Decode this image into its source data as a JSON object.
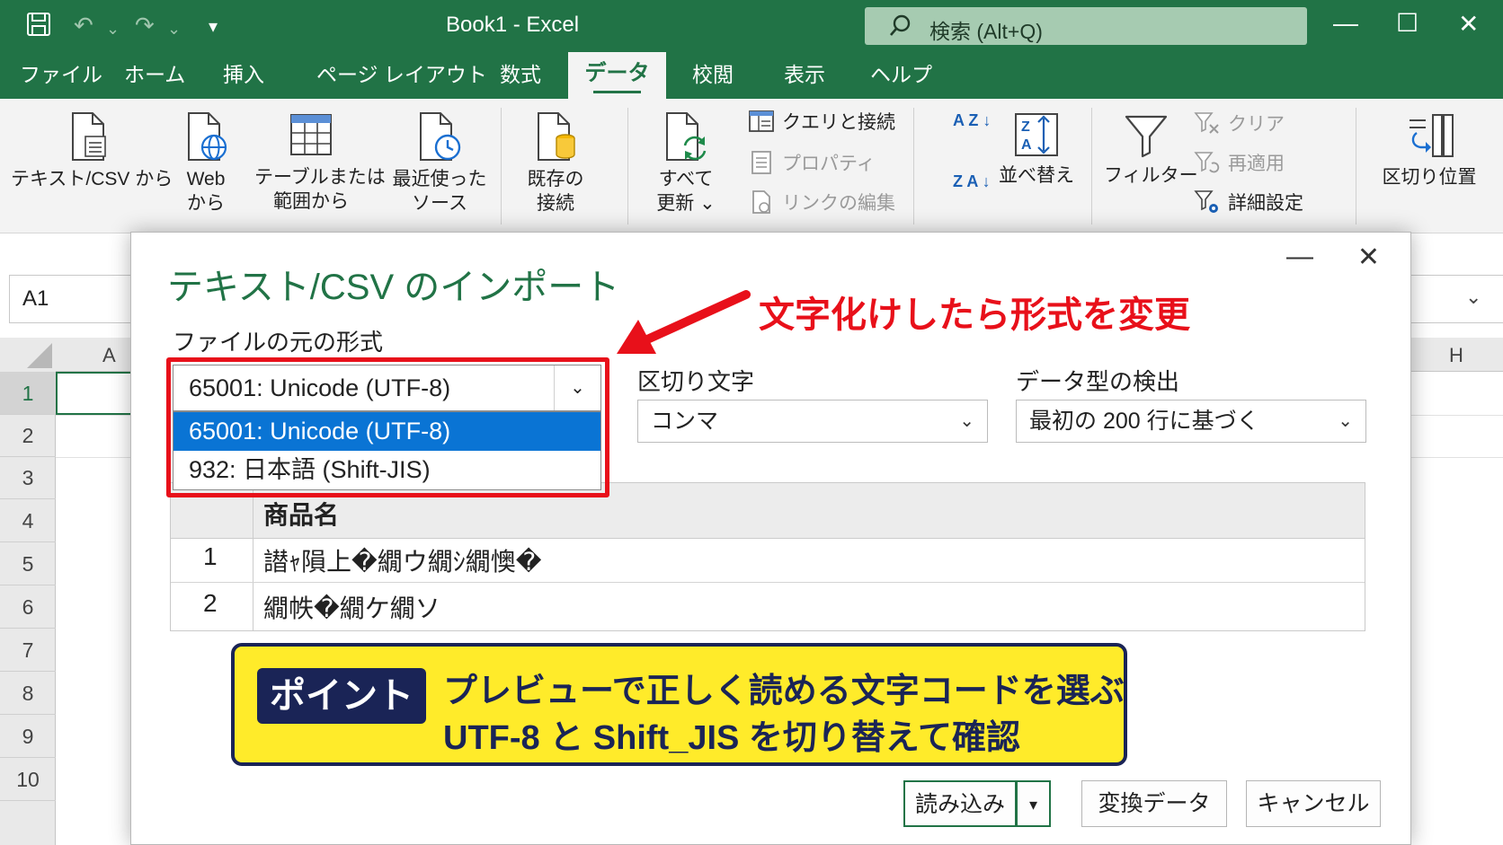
{
  "titlebar": {
    "doc_title": "Book1  -  Excel",
    "search_placeholder": "検索 (Alt+Q)",
    "undo_dropdown": "⌄",
    "redo_dropdown": "⌄",
    "customize_glyph": "▾",
    "minimize_glyph": "—",
    "maximize_glyph": "☐",
    "close_glyph": "✕"
  },
  "tabs": [
    {
      "label": "ファイル"
    },
    {
      "label": "ホーム"
    },
    {
      "label": "挿入"
    },
    {
      "label": "ページ レイアウト"
    },
    {
      "label": "数式"
    },
    {
      "label": "データ"
    },
    {
      "label": "校閲"
    },
    {
      "label": "表示"
    },
    {
      "label": "ヘルプ"
    }
  ],
  "ribbon": {
    "text_csv_line1": "テキスト/CSV から",
    "web_line1": "Web",
    "web_line2": "から",
    "table_line1": "テーブルまたは",
    "table_line2": "範囲から",
    "recent_line1": "最近使った",
    "recent_line2": "ソース",
    "existing_line1": "既存の",
    "existing_line2": "接続",
    "refresh_line1": "すべて",
    "refresh_line2": "更新 ⌄",
    "queries": "クエリと接続",
    "properties": "プロパティ",
    "edit_links": "リンクの編集",
    "sort_az": "A Z ↓",
    "sort_za": "Z A ↓",
    "sort": "並べ替え",
    "filter": "フィルター",
    "clear": "クリア",
    "reapply": "再適用",
    "advanced": "詳細設定",
    "text_to_columns": "区切り位置"
  },
  "sheet": {
    "name_box": "A1",
    "formula_chevron": "⌄",
    "col_a": "A",
    "col_h": "H",
    "rows": [
      "1",
      "2",
      "3",
      "4",
      "5",
      "6",
      "7",
      "8",
      "9",
      "10"
    ]
  },
  "dialog": {
    "title": "テキスト/CSV のインポート",
    "minimize": "—",
    "close": "✕",
    "encoding_label": "ファイルの元の形式",
    "encoding_selected": "65001: Unicode (UTF-8)",
    "encoding_options": [
      {
        "label": "65001: Unicode (UTF-8)",
        "highlighted": true
      },
      {
        "label": "932: 日本語 (Shift-JIS)",
        "highlighted": false
      }
    ],
    "delimiter_label": "区切り文字",
    "delimiter_value": "コンマ",
    "detect_label": "データ型の検出",
    "detect_value": "最初の 200 行に基づく",
    "chevron": "⌄",
    "preview": {
      "header": "商品名",
      "rows": [
        {
          "index": "1",
          "value": "譛ｬ隕上�繝ウ繝ｼ繝懊�"
        },
        {
          "index": "2",
          "value": "繝帙�繝ケ繝ソ"
        }
      ]
    },
    "buttons": {
      "load": "読み込み",
      "load_dropdown": "▾",
      "transform": "変換データ",
      "cancel": "キャンセル"
    }
  },
  "annotation": {
    "callout": "文字化けしたら形式を変更",
    "callout_color": "#e8101a",
    "point_badge": "ポイント",
    "point_line1": "プレビューで正しく読める文字コードを選ぶ",
    "point_line2": "UTF-8 と Shift_JIS を切り替えて確認"
  },
  "colors": {
    "excel_green": "#217346",
    "selection_blue": "#0a74d4",
    "point_yellow": "#ffeb2a",
    "point_navy": "#1a2456"
  }
}
